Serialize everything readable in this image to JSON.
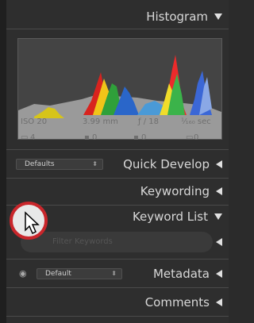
{
  "panels": {
    "histogram": {
      "title": "Histogram"
    },
    "quick_develop": {
      "title": "Quick Develop",
      "preset": "Defaults"
    },
    "keywording": {
      "title": "Keywording"
    },
    "keyword_list": {
      "title": "Keyword List",
      "search_placeholder": "Filter Keywords"
    },
    "metadata": {
      "title": "Metadata",
      "preset": "Default"
    },
    "comments": {
      "title": "Comments"
    }
  },
  "exif": {
    "iso": "ISO 20",
    "focal": "3.99 mm",
    "aperture": "ƒ / 18",
    "shutter": "¹⁄₁₆₀ sec"
  },
  "hist_icons": {
    "crop": "4",
    "a": "0",
    "b": "0",
    "c": "0"
  },
  "colors": {
    "accent": "#c9262b",
    "panel": "#2e2e2e"
  }
}
